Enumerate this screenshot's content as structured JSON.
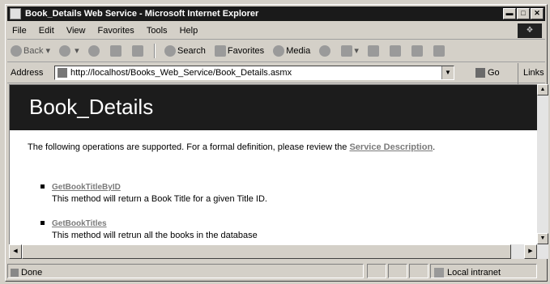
{
  "window": {
    "title": "Book_Details Web Service - Microsoft Internet Explorer"
  },
  "menu": [
    "File",
    "Edit",
    "View",
    "Favorites",
    "Tools",
    "Help"
  ],
  "toolbar": {
    "back": "Back",
    "search": "Search",
    "favorites": "Favorites",
    "media": "Media"
  },
  "address": {
    "label": "Address",
    "url": "http://localhost/Books_Web_Service/Book_Details.asmx",
    "go": "Go",
    "links": "Links"
  },
  "page": {
    "heading": "Book_Details",
    "intro": "The following operations are supported. For a formal definition, please review the",
    "service_link": "Service Description",
    "intro_end": ".",
    "operations": [
      {
        "name": "GetBookTitleByID",
        "description": "This method will return a Book Title for a given Title ID."
      },
      {
        "name": "GetBookTitles",
        "description": "This method will retrun all the books in the database"
      }
    ]
  },
  "status": {
    "text": "Done",
    "zone": "Local intranet"
  }
}
